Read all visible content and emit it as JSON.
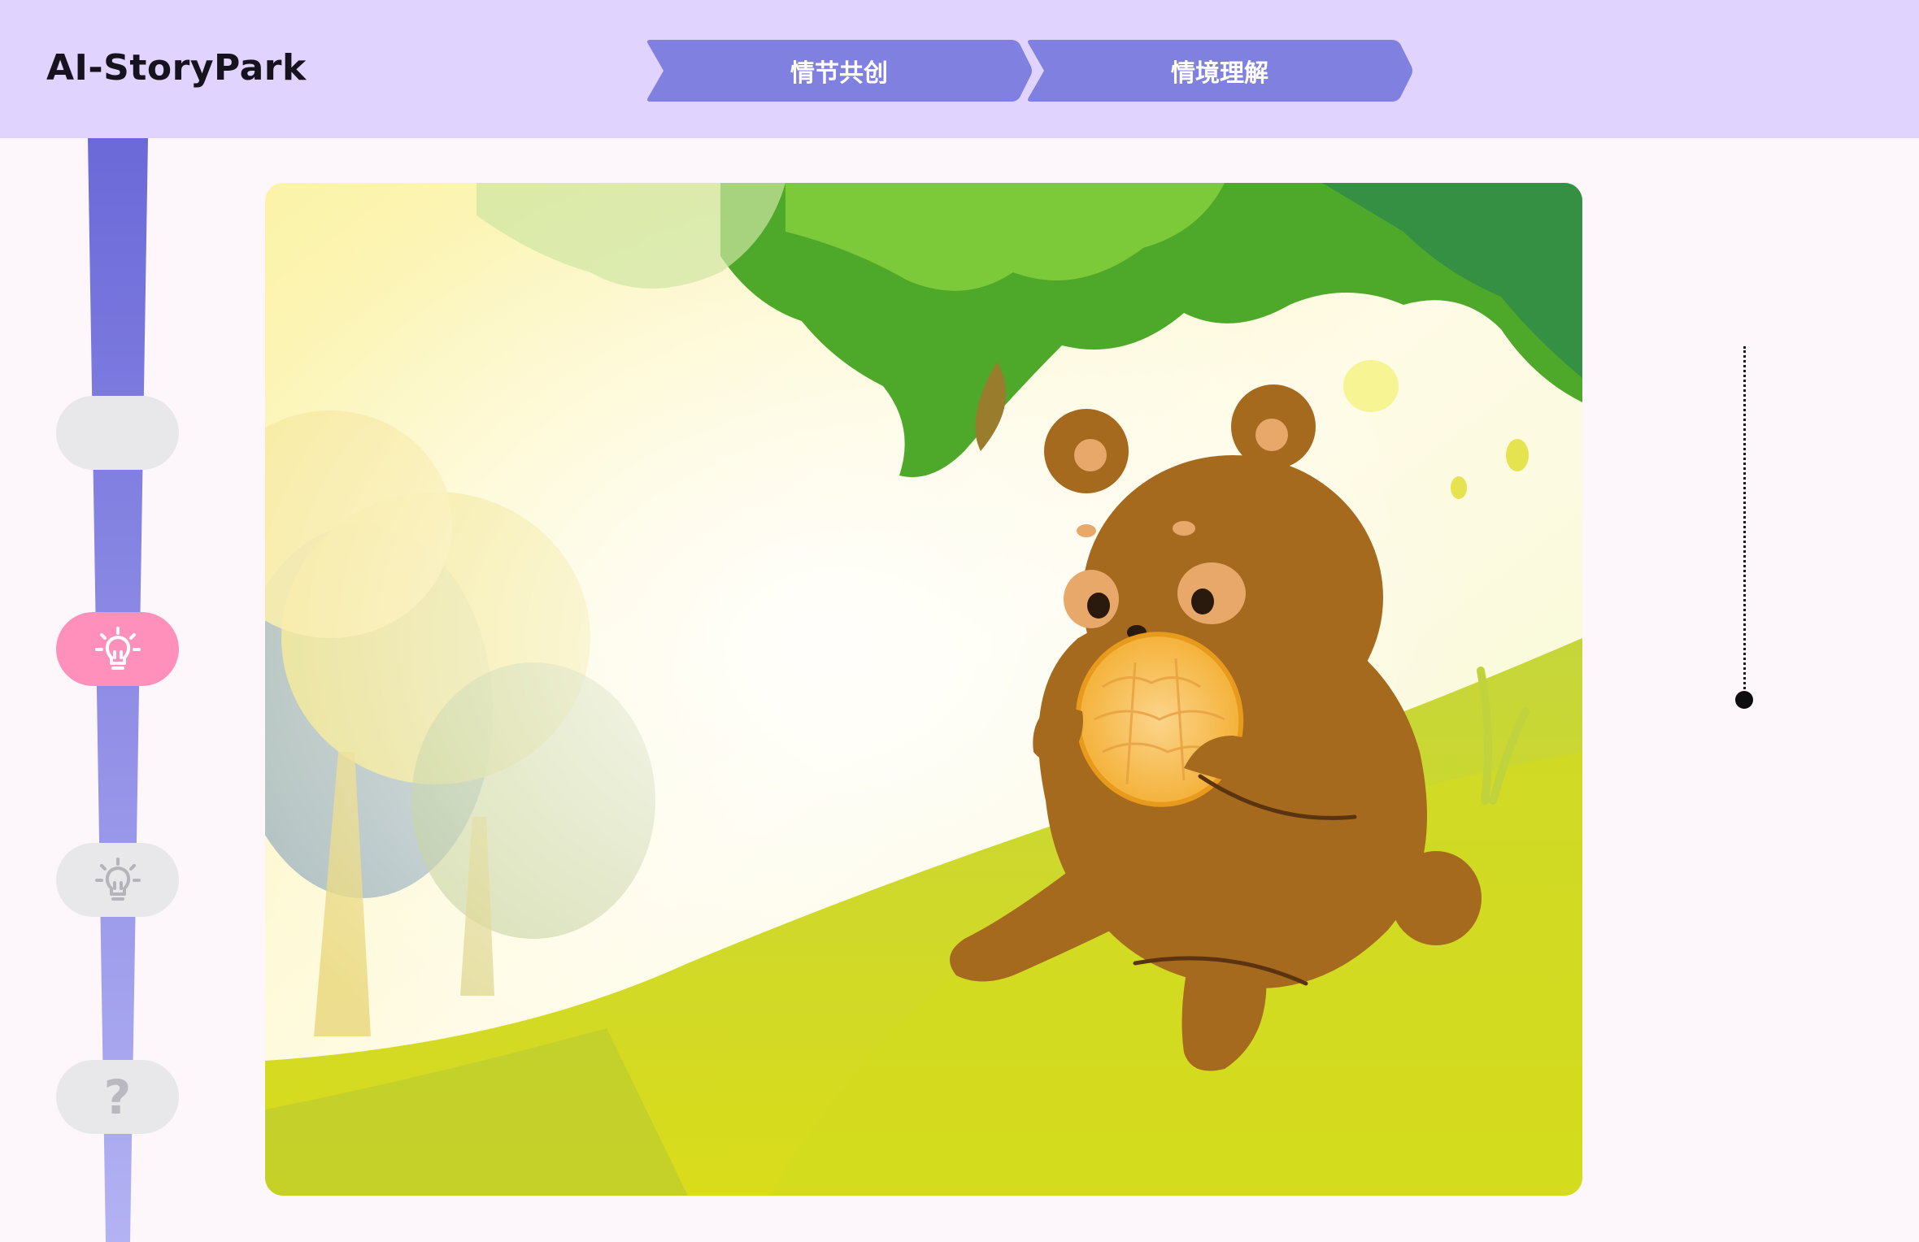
{
  "app": {
    "title": "AI-StoryPark"
  },
  "steps": [
    {
      "label": "情节共创",
      "color": "#8080e0"
    },
    {
      "label": "情境理解",
      "color": "#8080e0"
    }
  ],
  "sidebar": {
    "track_color_top": "#6b69d8",
    "track_color_bottom": "#b3b2f3",
    "buttons": [
      {
        "icon": "blank",
        "state": "inactive"
      },
      {
        "icon": "lightbulb-icon",
        "state": "active",
        "color": "#ff8fbb"
      },
      {
        "icon": "lightbulb-icon",
        "state": "inactive"
      },
      {
        "icon": "question-icon",
        "label": "?",
        "state": "inactive"
      }
    ]
  },
  "scene": {
    "illustration": "bear-eating-honey-cookie-under-tree",
    "progress": 1.0
  },
  "colors": {
    "topbar": "#e0d3fd",
    "background": "#fdf7fc",
    "active": "#ff8fbb",
    "inactive": "#e8e8ea"
  }
}
